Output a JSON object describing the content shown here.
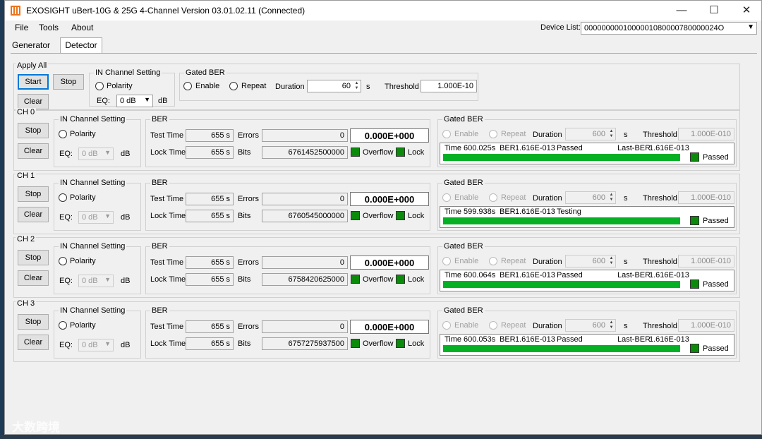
{
  "window": {
    "title": "EXOSIGHT uBert-10G & 25G 4-Channel Version 03.01.02.11    (Connected)",
    "minimize": "—",
    "maximize": "☐",
    "close": "✕"
  },
  "menu": [
    "File",
    "Tools",
    "About"
  ],
  "device": {
    "label": "Device List:",
    "value": "0000000001000001080000780000024O"
  },
  "tabs": [
    "Generator",
    "Detector"
  ],
  "apply_all": {
    "title": "Apply All",
    "start": "Start",
    "stop": "Stop",
    "clear": "Clear",
    "in_title": "IN Channel Setting",
    "polarity": "Polarity",
    "eq_label": "EQ:",
    "eq_value": "0 dB",
    "db": "dB",
    "gated_title": "Gated BER",
    "enable": "Enable",
    "repeat": "Repeat",
    "duration_label": "Duration",
    "duration": "60",
    "s": "s",
    "threshold_label": "Threshold",
    "threshold": "1.000E-10"
  },
  "labels": {
    "stop": "Stop",
    "clear": "Clear",
    "in_title": "IN Channel Setting",
    "polarity": "Polarity",
    "eq": "EQ:",
    "db": "dB",
    "ber": "BER",
    "test_time": "Test Time",
    "lock_time": "Lock Time",
    "errors": "Errors",
    "bits": "Bits",
    "overflow": "Overflow",
    "lock": "Lock",
    "gated": "Gated BER",
    "enable": "Enable",
    "repeat": "Repeat",
    "duration": "Duration",
    "s": "s",
    "threshold": "Threshold",
    "passed": "Passed",
    "time_lbl": "Time",
    "ber_lbl": "BER",
    "last_ber_lbl": "Last-BER"
  },
  "channels": [
    {
      "name": "CH 0",
      "eq": "0 dB",
      "test_time": "655 s",
      "lock_time": "655 s",
      "errors": "0",
      "bits": "6761452500000",
      "ber": "0.000E+000",
      "duration": "600",
      "threshold": "1.000E-010",
      "time": "600.025s",
      "gber": "1.616E-013",
      "state": "Passed",
      "last_ber": "1.616E-013",
      "progress": 1.0
    },
    {
      "name": "CH 1",
      "eq": "0 dB",
      "test_time": "655 s",
      "lock_time": "655 s",
      "errors": "0",
      "bits": "6760545000000",
      "ber": "0.000E+000",
      "duration": "600",
      "threshold": "1.000E-010",
      "time": "599.938s",
      "gber": "1.616E-013",
      "state": "Testing",
      "last_ber": "",
      "progress": 1.0
    },
    {
      "name": "CH 2",
      "eq": "0 dB",
      "test_time": "655 s",
      "lock_time": "655 s",
      "errors": "0",
      "bits": "6758420625000",
      "ber": "0.000E+000",
      "duration": "600",
      "threshold": "1.000E-010",
      "time": "600.064s",
      "gber": "1.616E-013",
      "state": "Passed",
      "last_ber": "1.616E-013",
      "progress": 1.0
    },
    {
      "name": "CH 3",
      "eq": "0 dB",
      "test_time": "655 s",
      "lock_time": "655 s",
      "errors": "0",
      "bits": "6757275937500",
      "ber": "0.000E+000",
      "duration": "600",
      "threshold": "1.000E-010",
      "time": "600.053s",
      "gber": "1.616E-013",
      "state": "Passed",
      "last_ber": "1.616E-013",
      "progress": 1.0
    }
  ],
  "watermark": "大数跨境",
  "colors": {
    "progress": "#06b025",
    "indicator": "#0b8a0b",
    "accent": "#0078d7",
    "brand": "#e8741c"
  }
}
